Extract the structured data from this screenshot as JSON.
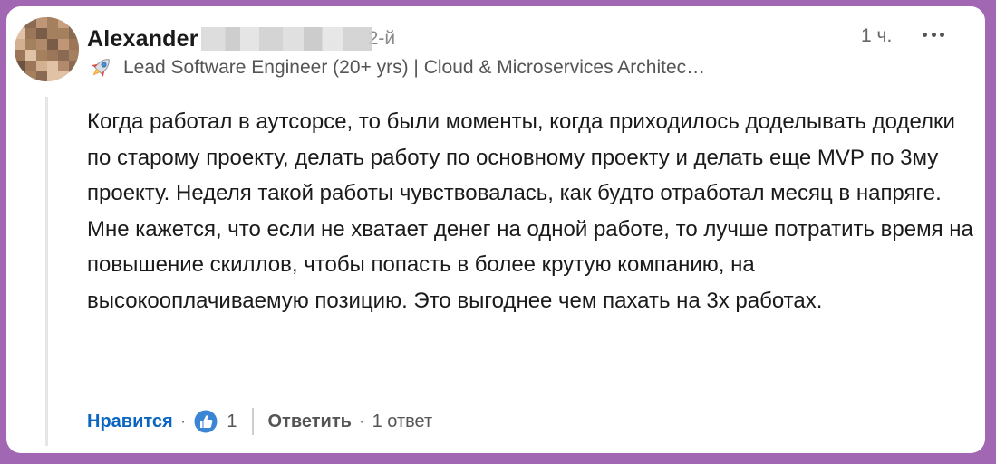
{
  "comment": {
    "author": {
      "name": "Alexander",
      "degree": "2-й",
      "headline_icon": "rocket-icon",
      "headline": "Lead Software Engineer (20+ yrs) | Cloud & Microservices Architec…"
    },
    "time": "1 ч.",
    "more_icon": "more-horizontal-icon",
    "paragraphs": [
      "Когда работал в аутсорсе, то были моменты, когда приходилось доделывать доделки по старому проекту, делать работу по основному проекту и делать еще MVP по 3му проекту. Неделя такой работы чувствовалась, как будто отработал месяц в напряге.",
      "Мне кажется, что если не хватает денег на одной работе, то лучше потратить время на повышение скиллов, чтобы попасть в более крутую компанию, на высокооплачиваемую позицию. Это выгоднее чем пахать на 3х работах."
    ],
    "actions": {
      "like_label": "Нравится",
      "separator": "·",
      "reaction_icon": "thumbs-up-icon",
      "reaction_count": "1",
      "reply_label": "Ответить",
      "replies_count_label": "1 ответ"
    }
  },
  "colors": {
    "frame": "#a267b3",
    "link_blue": "#0a66c2",
    "text": "#1a1a1a",
    "muted": "#555555"
  }
}
